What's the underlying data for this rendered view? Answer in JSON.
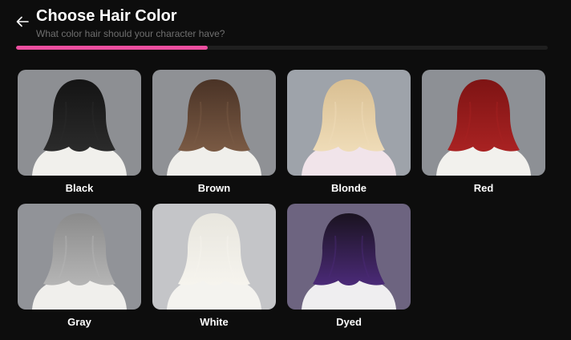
{
  "header": {
    "title": "Choose Hair Color",
    "subtitle": "What color hair should your character have?"
  },
  "progress": {
    "fraction": 0.36
  },
  "colors": {
    "accent": "#ec4fa0"
  },
  "options": [
    {
      "label": "Black",
      "hair": "#141414",
      "hair_light": "#2b2b2b",
      "bg": "#8d8f93",
      "shirt": "#f1f0ec"
    },
    {
      "label": "Brown",
      "hair": "#4a3326",
      "hair_light": "#7a5a44",
      "bg": "#8f9195",
      "shirt": "#f0efeb"
    },
    {
      "label": "Blonde",
      "hair": "#d9bf92",
      "hair_light": "#efdcb8",
      "bg": "#9ea3aa",
      "shirt": "#f1e4ea"
    },
    {
      "label": "Red",
      "hair": "#7e1414",
      "hair_light": "#a92222",
      "bg": "#8d9095",
      "shirt": "#f2f1ed"
    },
    {
      "label": "Gray",
      "hair": "#8b8b8b",
      "hair_light": "#b5b5b5",
      "bg": "#919398",
      "shirt": "#f0efec"
    },
    {
      "label": "White",
      "hair": "#e8e6de",
      "hair_light": "#f6f4ee",
      "bg": "#c4c5c8",
      "shirt": "#f4f3ef"
    },
    {
      "label": "Dyed",
      "hair": "#1a1320",
      "hair_light": "#4b2a78",
      "bg": "#6d6480",
      "shirt": "#efeef0"
    }
  ]
}
